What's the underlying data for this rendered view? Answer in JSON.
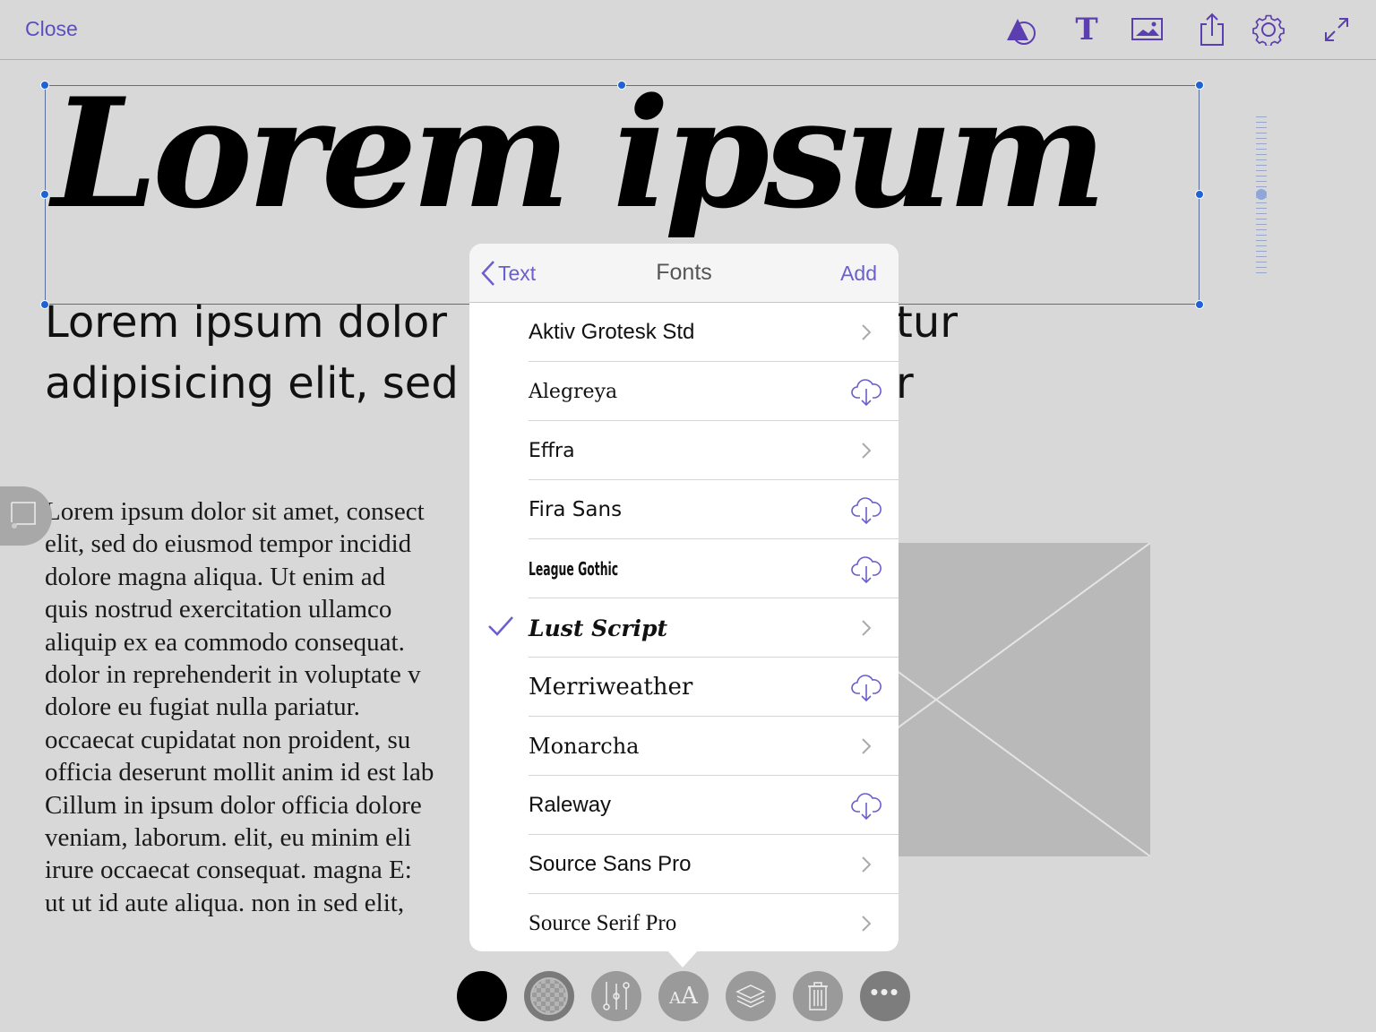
{
  "topbar": {
    "close_label": "Close",
    "icons": [
      "shapes-icon",
      "text-icon",
      "image-icon",
      "share-icon",
      "gear-icon",
      "expand-icon"
    ]
  },
  "canvas": {
    "headline": "Lorem ipsum",
    "subheading_lines": [
      "Lorem ipsum dolor",
      "adipisicing elit, sed"
    ],
    "subheading_right": [
      "tur",
      "r"
    ],
    "body_lines": [
      "Lorem ipsum dolor sit amet, consect",
      "elit, sed do eiusmod tempor incidid",
      "dolore magna aliqua. Ut enim ad",
      "quis nostrud exercitation ullamco",
      "aliquip ex ea commodo consequat.",
      "dolor in reprehenderit in voluptate v",
      "dolore eu fugiat nulla pariatur.",
      "occaecat cupidatat non proident, su",
      "officia deserunt mollit anim id est lab",
      "Cillum in ipsum dolor officia dolore",
      "veniam, laborum. elit, eu minim eli",
      "irure occaecat consequat. magna E:",
      "ut ut id aute aliqua. non in sed elit,"
    ]
  },
  "fonts_popover": {
    "back_label": "Text",
    "title": "Fonts",
    "add_label": "Add",
    "items": [
      {
        "name": "Aktiv Grotesk Std",
        "action": "chevron"
      },
      {
        "name": "Alegreya",
        "action": "download"
      },
      {
        "name": "Effra",
        "action": "chevron"
      },
      {
        "name": "Fira Sans",
        "action": "download"
      },
      {
        "name": "League Gothic",
        "action": "download"
      },
      {
        "name": "Lust Script",
        "action": "chevron",
        "selected": true
      },
      {
        "name": "Merriweather",
        "action": "download"
      },
      {
        "name": "Monarcha",
        "action": "chevron"
      },
      {
        "name": "Raleway",
        "action": "download"
      },
      {
        "name": "Source Sans Pro",
        "action": "chevron"
      },
      {
        "name": "Source Serif Pro",
        "action": "chevron"
      }
    ]
  },
  "bottom_toolbar": {
    "buttons": [
      "fill-color",
      "opacity",
      "adjust",
      "font",
      "layers",
      "delete",
      "more"
    ]
  },
  "colors": {
    "accent": "#5b4fc0",
    "selection": "#1e63d6",
    "background": "#d8d8d8"
  }
}
